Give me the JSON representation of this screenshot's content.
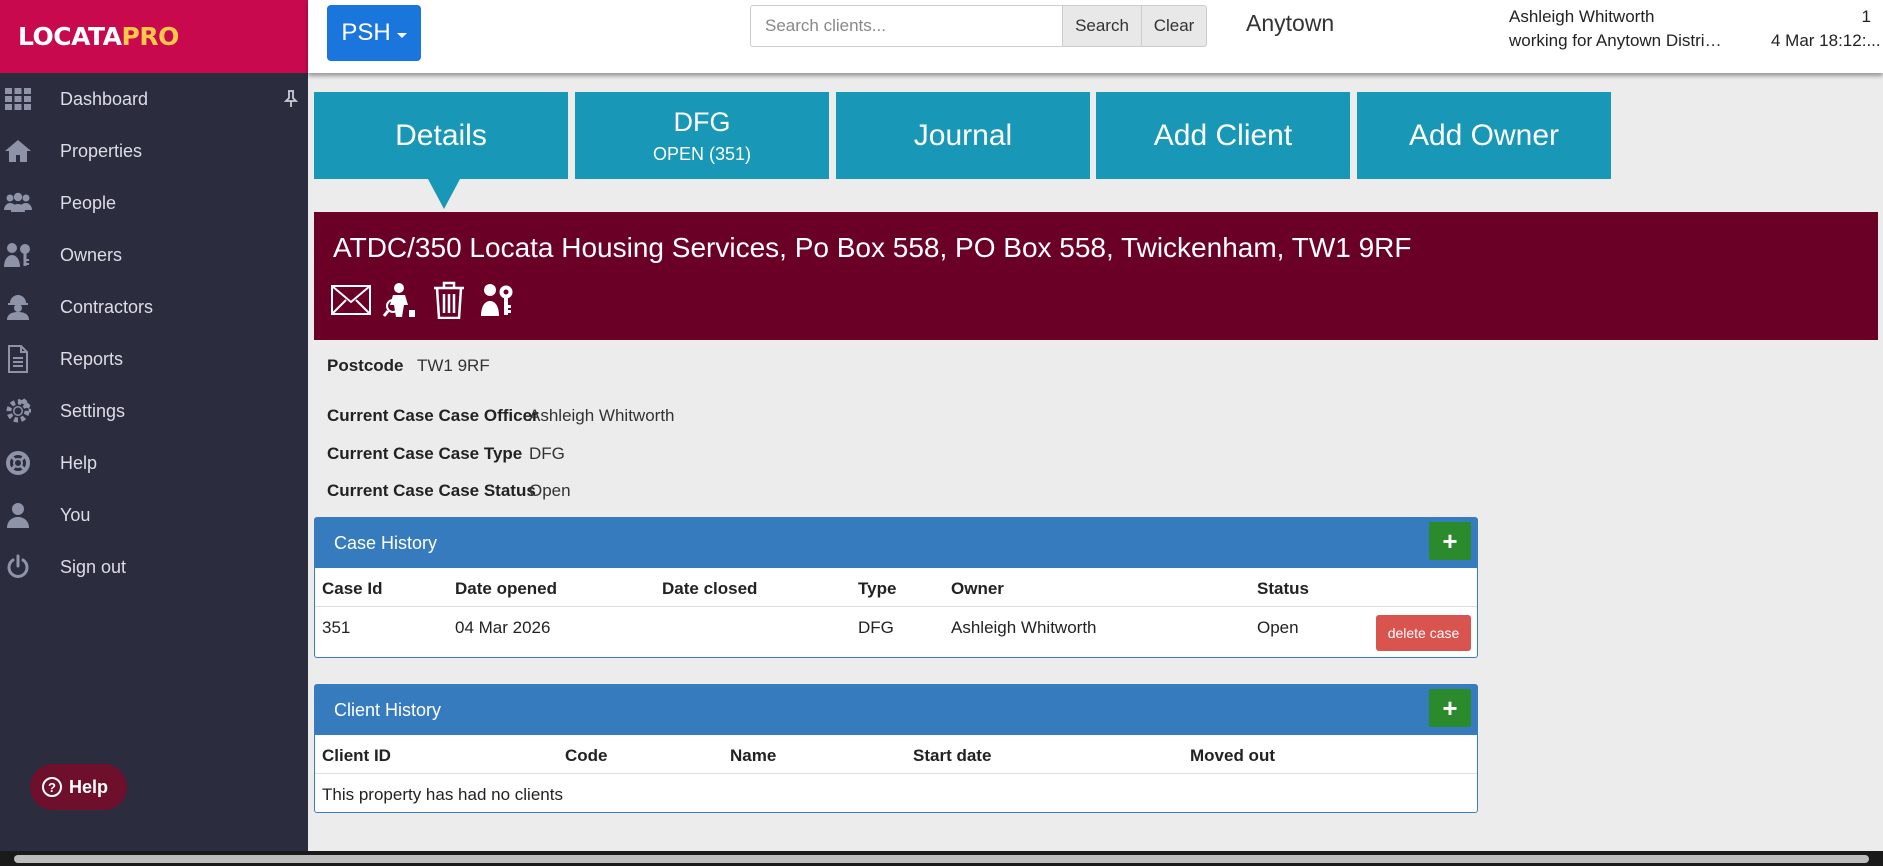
{
  "logo": {
    "brand": "LOCATA",
    "suffix": "PRO"
  },
  "sidebar": {
    "items": [
      {
        "label": "Dashboard",
        "icon": "grid-icon"
      },
      {
        "label": "Properties",
        "icon": "house-icon"
      },
      {
        "label": "People",
        "icon": "people-icon"
      },
      {
        "label": "Owners",
        "icon": "owner-key-icon"
      },
      {
        "label": "Contractors",
        "icon": "contractor-icon"
      },
      {
        "label": "Reports",
        "icon": "report-icon"
      },
      {
        "label": "Settings",
        "icon": "gear-icon"
      },
      {
        "label": "Help",
        "icon": "lifebuoy-icon"
      },
      {
        "label": "You",
        "icon": "user-icon"
      },
      {
        "label": "Sign out",
        "icon": "power-icon"
      }
    ],
    "help_button": "Help"
  },
  "topbar": {
    "org_button": "PSH",
    "search_placeholder": "Search clients...",
    "search_button": "Search",
    "clear_button": "Clear",
    "town": "Anytown",
    "user_name": "Ashleigh Whitworth",
    "user_org": "working for Anytown District C...",
    "notification_count": "1",
    "datetime": "4 Mar 18:12:..."
  },
  "tabs": [
    {
      "label": "Details",
      "sub": ""
    },
    {
      "label": "DFG",
      "sub": "OPEN (351)"
    },
    {
      "label": "Journal",
      "sub": ""
    },
    {
      "label": "Add Client",
      "sub": ""
    },
    {
      "label": "Add Owner",
      "sub": ""
    }
  ],
  "property": {
    "title": "ATDC/350 Locata Housing Services, Po Box 558, PO Box 558, Twickenham, TW1 9RF",
    "actions": [
      "mail-icon",
      "inspect-icon",
      "trash-icon",
      "owner-key-icon"
    ]
  },
  "fields": {
    "postcode_label": "Postcode",
    "postcode": "TW1 9RF",
    "officer_label": "Current Case Case Officer",
    "officer": "Ashleigh Whitworth",
    "type_label": "Current Case Case Type",
    "type": "DFG",
    "status_label": "Current Case Case Status",
    "status": "Open"
  },
  "case_history": {
    "title": "Case History",
    "add": "+",
    "columns": [
      "Case Id",
      "Date opened",
      "Date closed",
      "Type",
      "Owner",
      "Status"
    ],
    "rows": [
      {
        "case_id": "351",
        "date_opened": "04 Mar 2026",
        "date_closed": "",
        "type": "DFG",
        "owner": "Ashleigh Whitworth",
        "status": "Open",
        "action": "delete case"
      }
    ]
  },
  "client_history": {
    "title": "Client History",
    "add": "+",
    "columns": [
      "Client ID",
      "Code",
      "Name",
      "Start date",
      "Moved out"
    ],
    "empty": "This property has had no clients"
  },
  "colors": {
    "brand": "#c8094e",
    "sidebar": "#2b2d3e",
    "tab": "#1898b6",
    "banner": "#6b0026",
    "panel_head": "#357bbd",
    "add_button": "#2a8a2c",
    "delete_button": "#d9534f"
  }
}
